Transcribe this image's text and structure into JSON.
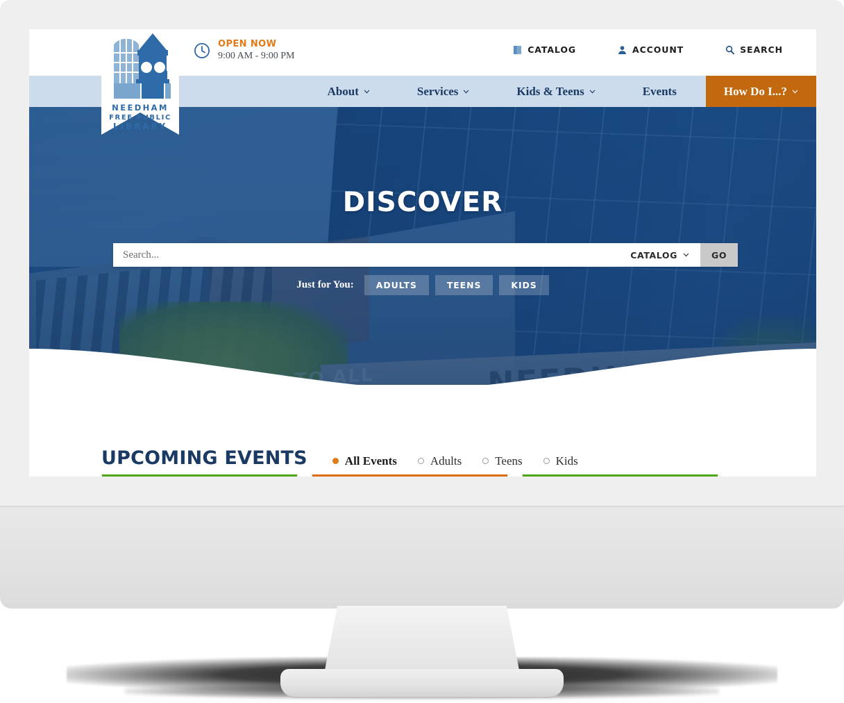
{
  "site": {
    "logo": {
      "line1": "NEEDHAM",
      "line2": "FREE PUBLIC",
      "line3": "LIBRARY",
      "icon": "library-clock-tower-icon"
    }
  },
  "utility_bar": {
    "clock_icon": "clock-icon",
    "status_label": "OPEN NOW",
    "hours": "9:00 AM - 9:00 PM",
    "links": [
      {
        "label": "CATALOG",
        "icon": "book-icon"
      },
      {
        "label": "ACCOUNT",
        "icon": "person-icon"
      },
      {
        "label": "SEARCH",
        "icon": "search-icon"
      }
    ]
  },
  "main_nav": {
    "items": [
      {
        "label": "About",
        "has_dropdown": true,
        "highlighted": false
      },
      {
        "label": "Services",
        "has_dropdown": true,
        "highlighted": false
      },
      {
        "label": "Kids & Teens",
        "has_dropdown": true,
        "highlighted": false
      },
      {
        "label": "Events",
        "has_dropdown": false,
        "highlighted": false
      },
      {
        "label": "How Do I...?",
        "has_dropdown": true,
        "highlighted": true
      }
    ],
    "bar_color": "#ccdcec",
    "highlight_color": "#c2680e",
    "text_color": "#1b3a63"
  },
  "hero": {
    "title": "DISCOVER",
    "background_alt": "Needham Free Public Library building exterior with blue glass facade",
    "facade_text": "NEEDHAM FREE PUBL",
    "facade_text_secondary": "FREE TO ALL",
    "overlay_color": "#1a487e",
    "search": {
      "placeholder": "Search...",
      "value": "",
      "scope_label": "CATALOG",
      "scope_icon": "chevron-down-icon",
      "submit_label": "GO"
    },
    "just_for_you": {
      "label": "Just for You:",
      "buttons": [
        "ADULTS",
        "TEENS",
        "KIDS"
      ]
    }
  },
  "events_section": {
    "title": "UPCOMING EVENTS",
    "filters": [
      {
        "label": "All Events",
        "selected": true
      },
      {
        "label": "Adults",
        "selected": false
      },
      {
        "label": "Teens",
        "selected": false
      },
      {
        "label": "Kids",
        "selected": false
      }
    ],
    "selected_color": "#e07b17",
    "cards": [
      {
        "accent_color": "#4ca614"
      },
      {
        "accent_color": "#dd6b10"
      },
      {
        "accent_color": "#4ca614"
      }
    ]
  }
}
